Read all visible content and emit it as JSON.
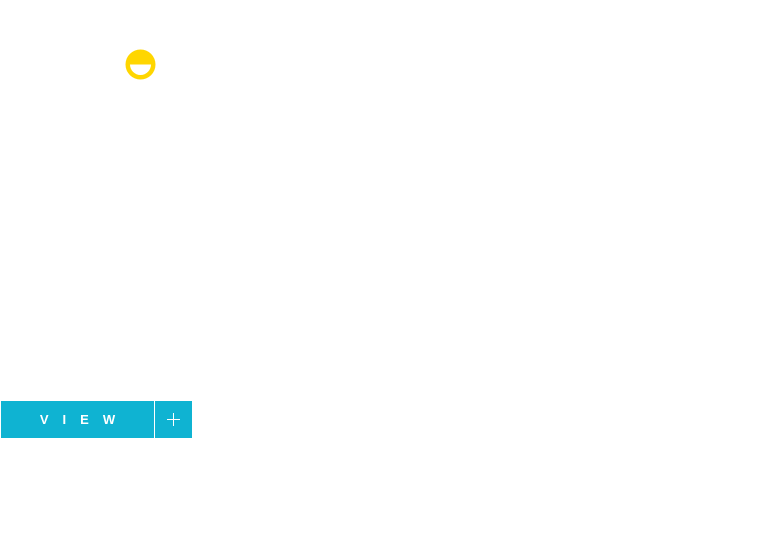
{
  "brand": {
    "logo_icon": "smiley-face-icon",
    "logo_color": "#ffd600"
  },
  "view_button": {
    "label": "VIEW",
    "icon": "plus-icon",
    "background": "#0fb3d2",
    "text_color": "#ffffff"
  }
}
